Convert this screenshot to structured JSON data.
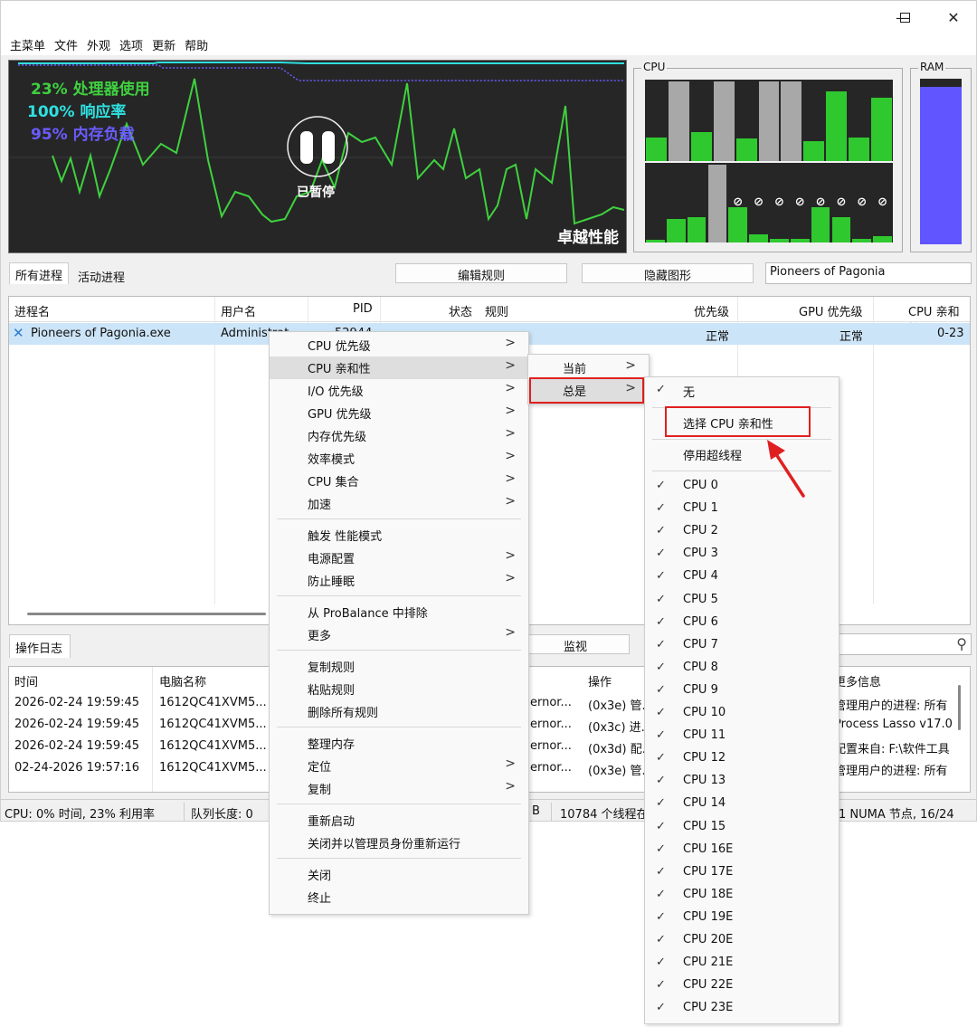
{
  "window": {
    "minimize": "—",
    "maximize": "☐",
    "close": "✕"
  },
  "menubar": [
    "主菜单",
    "文件",
    "外观",
    "选项",
    "更新",
    "帮助"
  ],
  "graph": {
    "cpu_usage": "23% 处理器使用",
    "responsiveness": "100% 响应率",
    "memory_load": "95% 内存负载",
    "paused": "已暂停",
    "performance": "卓越性能",
    "colors": {
      "cpu": "#3fd13f",
      "resp": "#30e0e0",
      "mem": "#6a5cff"
    }
  },
  "cpu_panel": {
    "label": "CPU",
    "row1": [
      {
        "level": 0.3,
        "parked": false
      },
      {
        "level": 1.0,
        "parked": true
      },
      {
        "level": 0.36,
        "parked": false
      },
      {
        "level": 1.0,
        "parked": true
      },
      {
        "level": 0.28,
        "parked": false
      },
      {
        "level": 1.0,
        "parked": true
      },
      {
        "level": 1.0,
        "parked": true
      },
      {
        "level": 0.25,
        "parked": false
      },
      {
        "level": 0.88,
        "parked": false
      },
      {
        "level": 0.3,
        "parked": false
      },
      {
        "level": 0.8,
        "parked": false
      }
    ],
    "row2": [
      {
        "level": 0.04,
        "parked": false,
        "eco": false
      },
      {
        "level": 0.3,
        "parked": false,
        "eco": false
      },
      {
        "level": 0.32,
        "parked": false,
        "eco": false
      },
      {
        "level": 1.0,
        "parked": true,
        "eco": false
      },
      {
        "level": 0.45,
        "parked": false,
        "eco": true
      },
      {
        "level": 0.1,
        "parked": false,
        "eco": true
      },
      {
        "level": 0.05,
        "parked": false,
        "eco": true
      },
      {
        "level": 0.05,
        "parked": false,
        "eco": true
      },
      {
        "level": 0.45,
        "parked": false,
        "eco": true
      },
      {
        "level": 0.33,
        "parked": false,
        "eco": true
      },
      {
        "level": 0.05,
        "parked": false,
        "eco": true
      },
      {
        "level": 0.08,
        "parked": false,
        "eco": true
      }
    ]
  },
  "ram_panel": {
    "label": "RAM",
    "level": 0.95
  },
  "tabs": {
    "all": "所有进程",
    "active": "活动进程"
  },
  "toolbar": {
    "edit_rules": "编辑规则",
    "hide_graph": "隐藏图形",
    "filter_value": "Pioneers of Pagonia"
  },
  "process_list": {
    "headers": [
      "进程名",
      "用户名",
      "PID",
      "状态",
      "规则",
      "优先级",
      "GPU 优先级",
      "CPU 亲和性"
    ],
    "row": {
      "name": "Pioneers of Pagonia.exe",
      "user": "Administrat",
      "pid": "52944",
      "status": "",
      "rules": "",
      "priority": "正常",
      "gpu_priority": "正常",
      "affinity": "0-23"
    }
  },
  "log": {
    "tab": "操作日志",
    "monitor": "监视",
    "headers": [
      "时间",
      "电脑名称",
      "操作",
      "更多信息"
    ],
    "rows": [
      {
        "time": "2026-02-24 19:59:45",
        "pc": "1612QC41XVM5...",
        "proc": "ernor...",
        "action": "(0x3e) 管...",
        "info": "管理用户的进程: 所有"
      },
      {
        "time": "2026-02-24 19:59:45",
        "pc": "1612QC41XVM5...",
        "proc": "ernor...",
        "action": "(0x3c) 进...",
        "info": "Process Lasso v17.0"
      },
      {
        "time": "2026-02-24 19:59:45",
        "pc": "1612QC41XVM5...",
        "proc": "ernor...",
        "action": "(0x3d) 配...",
        "info": "配置来自: F:\\软件工具"
      },
      {
        "time": "02-24-2026 19:57:16",
        "pc": "1612QC41XVM5...",
        "proc": "ernor...",
        "action": "(0x3e) 管...",
        "info": "管理用户的进程: 所有"
      }
    ]
  },
  "statusbar": {
    "cpu": "CPU: 0% 时间, 23% 利用率",
    "queue": "队列长度: 0",
    "mem": "B",
    "threads": "10784 个线程在",
    "numa": "1 NUMA 节点, 16/24"
  },
  "context_menu": {
    "items": [
      "CPU 优先级",
      "CPU 亲和性",
      "I/O 优先级",
      "GPU 优先级",
      "内存优先级",
      "效率模式",
      "CPU 集合",
      "加速",
      "触发 性能模式",
      "电源配置",
      "防止睡眠",
      "从 ProBalance 中排除",
      "更多",
      "复制规则",
      "粘贴规则",
      "删除所有规则",
      "整理内存",
      "定位",
      "复制",
      "重新启动",
      "关闭并以管理员身份重新运行",
      "关闭",
      "终止"
    ]
  },
  "affinity_menu": {
    "current": "当前",
    "always": "总是"
  },
  "always_menu": {
    "none": "无",
    "select": "选择 CPU 亲和性",
    "disable_ht": "停用超线程",
    "cpus": [
      "CPU 0",
      "CPU 1",
      "CPU 2",
      "CPU 3",
      "CPU 4",
      "CPU 5",
      "CPU 6",
      "CPU 7",
      "CPU 8",
      "CPU 9",
      "CPU 10",
      "CPU 11",
      "CPU 12",
      "CPU 13",
      "CPU 14",
      "CPU 15",
      "CPU 16E",
      "CPU 17E",
      "CPU 18E",
      "CPU 19E",
      "CPU 20E",
      "CPU 21E",
      "CPU 22E",
      "CPU 23E"
    ]
  },
  "icons": {
    "submenu_arrow": ">",
    "check": "✓",
    "search": "⚲"
  }
}
